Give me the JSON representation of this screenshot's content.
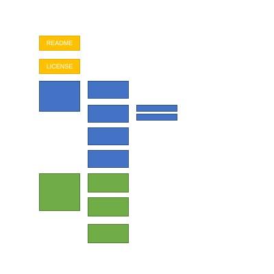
{
  "files": {
    "readme_label": "README",
    "license_label": "LICENSE"
  },
  "colors": {
    "file_boxes": "#FFC000",
    "blue_group": "#4472C4",
    "green_group": "#70AD47"
  }
}
